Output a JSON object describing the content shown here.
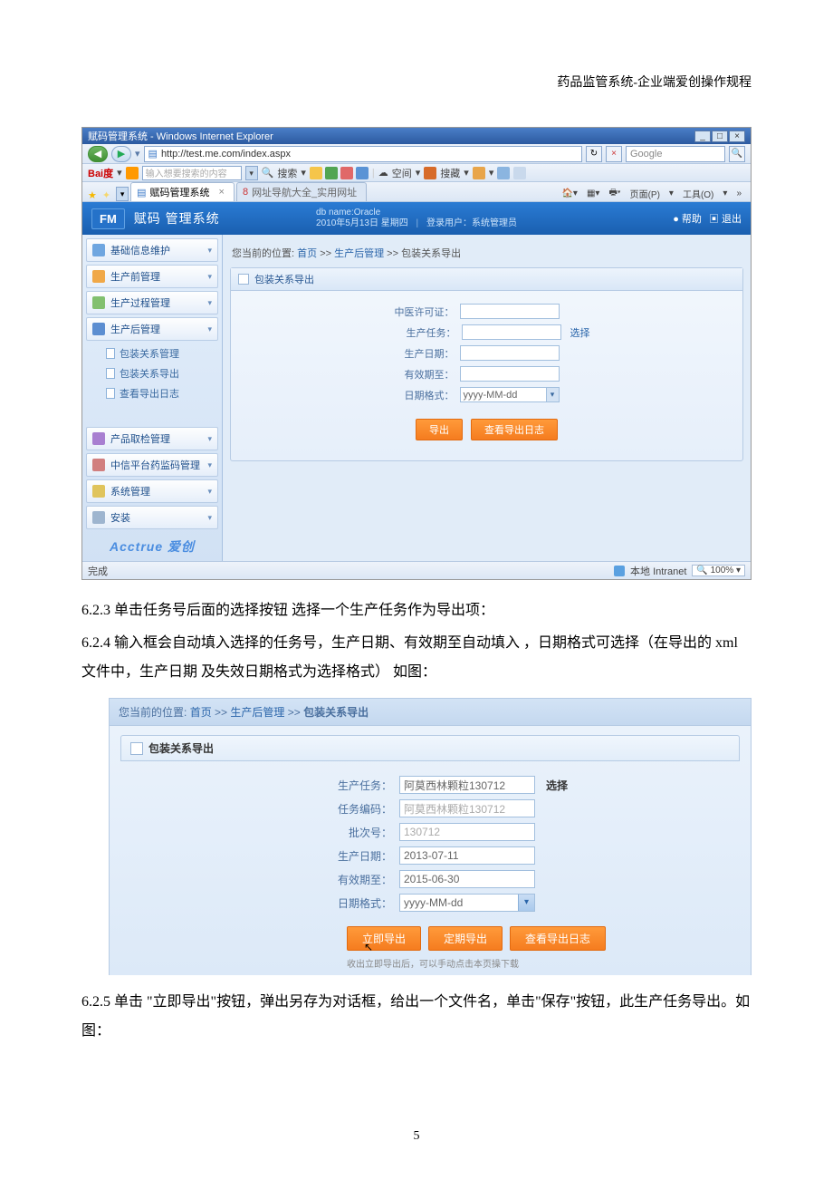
{
  "doc": {
    "header": "药品监管系统-企业端爱创操作规程",
    "p1": "6.2.3 单击任务号后面的选择按钮 选择一个生产任务作为导出项：",
    "p2": "6.2.4 输入框会自动填入选择的任务号，生产日期、有效期至自动填入 ，日期格式可选择（在导出的 xml 文件中，生产日期 及失效日期格式为选择格式）  如图：",
    "p3": "6.2.5 单击 \"立即导出\"按钮，弹出另存为对话框，给出一个文件名，单击\"保存\"按钮，此生产任务导出。如图：",
    "page_number": "5"
  },
  "ie": {
    "window_title": "赋码管理系统 - Windows Internet Explorer",
    "url": "http://test.me.com/index.aspx",
    "search_placeholder": "Google",
    "baidu_label": "Bai度",
    "baidu_input_placeholder": "输入想要搜索的内容",
    "baidu_search_btn": "搜索",
    "baidu_space": "空间",
    "baidu_fav": "搜藏",
    "tab_active": "赋码管理系统",
    "tab_inactive": "网址导航大全_实用网址",
    "tabmenu": {
      "page": "页面(P)",
      "tools": "工具(O)"
    },
    "status_done": "完成",
    "status_zone": "本地 Intranet",
    "status_zoom": "100%"
  },
  "app": {
    "fm": "FM",
    "title": "赋码 管理系统",
    "db": "db name:Oracle",
    "date_line": "2010年5月13日 星期四",
    "user_line": "登录用户：系统管理员",
    "help": "● 帮助",
    "logout": "▣ 退出",
    "brand": "Acctrue 爱创",
    "sidebar": {
      "items": [
        "基础信息维护",
        "生产前管理",
        "生产过程管理",
        "生产后管理",
        "产品取检管理",
        "中信平台药监码管理",
        "系统管理",
        "安装"
      ],
      "sub": [
        "包装关系管理",
        "包装关系导出",
        "查看导出日志"
      ]
    },
    "breadcrumb": {
      "prefix": "您当前的位置:",
      "home": "首页",
      "sep": ">>",
      "l1": "生产后管理",
      "l2": "包装关系导出"
    },
    "panel_title": "包装关系导出",
    "form": {
      "license": "中医许可证：",
      "task": "生产任务：",
      "select_btn": "选择",
      "prod_date": "生产日期：",
      "expiry": "有效期至：",
      "date_fmt": "日期格式：",
      "date_fmt_value": "yyyy-MM-dd"
    },
    "buttons": {
      "export": "导出",
      "log": "查看导出日志"
    }
  },
  "shot2": {
    "breadcrumb": {
      "prefix": "您当前的位置:",
      "home": "首页",
      "l1": "生产后管理",
      "l2": "包装关系导出"
    },
    "panel_title": "包装关系导出",
    "form": {
      "task": "生产任务：",
      "task_value": "阿莫西林颗粒130712",
      "select_btn": "选择",
      "task_code": "任务编码：",
      "task_code_value": "阿莫西林颗粒130712",
      "batch": "批次号：",
      "batch_value": "130712",
      "prod_date": "生产日期：",
      "prod_date_value": "2013-07-11",
      "expiry": "有效期至：",
      "expiry_value": "2015-06-30",
      "date_fmt": "日期格式：",
      "date_fmt_value": "yyyy-MM-dd"
    },
    "buttons": {
      "now": "立即导出",
      "sched": "定期导出",
      "log": "查看导出日志"
    },
    "note": "收出立即导出后，可以手动点击本页操下载"
  }
}
